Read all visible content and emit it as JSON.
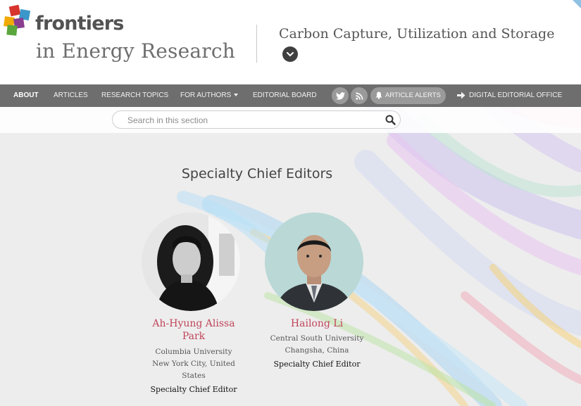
{
  "header": {
    "brand_name": "frontiers",
    "journal_name": "in Energy Research",
    "section_title": "Carbon Capture, Utilization and Storage"
  },
  "nav": {
    "items": [
      {
        "label": "ABOUT",
        "active": true
      },
      {
        "label": "ARTICLES",
        "active": false
      },
      {
        "label": "RESEARCH TOPICS",
        "active": false
      },
      {
        "label": "FOR AUTHORS",
        "active": false,
        "has_dropdown": true
      },
      {
        "label": "EDITORIAL BOARD",
        "active": false
      }
    ],
    "social_icons": [
      "twitter-icon",
      "rss-icon"
    ],
    "alerts_label": "ARTICLE ALERTS",
    "editorial_office_label": "DIGITAL EDITORIAL OFFICE"
  },
  "search": {
    "placeholder": "Search in this section"
  },
  "main": {
    "heading": "Specialty Chief Editors",
    "editors": [
      {
        "name_line1": "Ah-Hyung Alissa",
        "name_line2": "Park",
        "affiliation": "Columbia University",
        "location_line1": "New York City, United",
        "location_line2": "States",
        "role": "Specialty Chief Editor"
      },
      {
        "name_line1": "Hailong Li",
        "affiliation": "Central South University",
        "location_line1": "Changsha, China",
        "role": "Specialty Chief Editor"
      }
    ]
  },
  "colors": {
    "nav_background": "#6e6e6e",
    "editor_name": "#c0455a",
    "page_background": "#ededed",
    "toggle": "#3f3f3f"
  }
}
